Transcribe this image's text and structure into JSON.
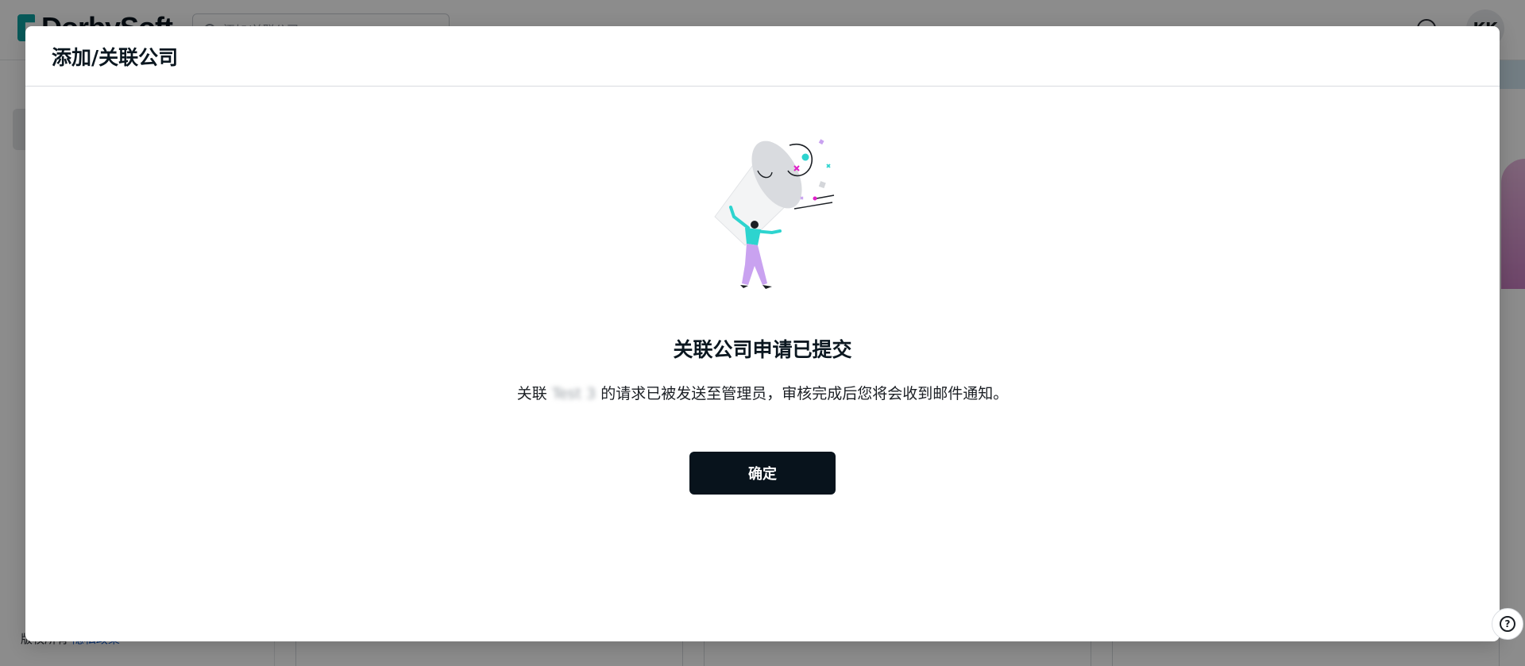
{
  "app": {
    "brand": "DorbySoft",
    "search_placeholder": "添加/关联公司",
    "avatar_initials": "KK",
    "footer_copyright": "版权所有",
    "footer_privacy": "隐私政策"
  },
  "modal": {
    "title": "添加/关联公司",
    "success_title": "关联公司申请已提交",
    "message_prefix": "关联",
    "company_name": "Test 3",
    "message_suffix": "的请求已被发送至管理员，审核完成后您将会收到邮件通知。",
    "confirm_label": "确定"
  },
  "help": {
    "glyph": "?"
  },
  "colors": {
    "primary_button": "#08131c",
    "accent_teal": "#0fa3a3",
    "figure_shirt": "#2dd4cf",
    "figure_pants": "#c9a2f0",
    "confetti_pink": "#e020c8"
  },
  "icons": [
    "search-icon",
    "help-icon",
    "user-avatar",
    "megaphone-illustration"
  ]
}
